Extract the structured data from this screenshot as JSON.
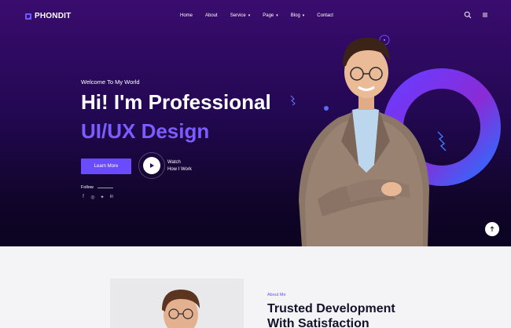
{
  "brand": {
    "name": "PHONDIT",
    "accent": "#6a4bff"
  },
  "nav": {
    "items": [
      {
        "label": "Home",
        "has_dropdown": false
      },
      {
        "label": "About",
        "has_dropdown": false
      },
      {
        "label": "Service",
        "has_dropdown": true
      },
      {
        "label": "Page",
        "has_dropdown": true
      },
      {
        "label": "Blog",
        "has_dropdown": true
      },
      {
        "label": "Contact",
        "has_dropdown": false
      }
    ],
    "icons": [
      "search-icon",
      "menu-icon"
    ]
  },
  "hero": {
    "greeting": "Welcome To My World",
    "title": "Hi! I'm Professional",
    "subtitle": "UI/UX Design",
    "cta_label": "Learn More",
    "watch_line1": "Watch",
    "watch_line2": "How I Work",
    "follow_label": "Follow",
    "socials": [
      "facebook-icon",
      "instagram-icon",
      "twitter-icon",
      "linkedin-icon"
    ]
  },
  "about": {
    "label": "About Me",
    "title_line1": "Trusted Development",
    "title_line2": "With Satisfaction"
  }
}
